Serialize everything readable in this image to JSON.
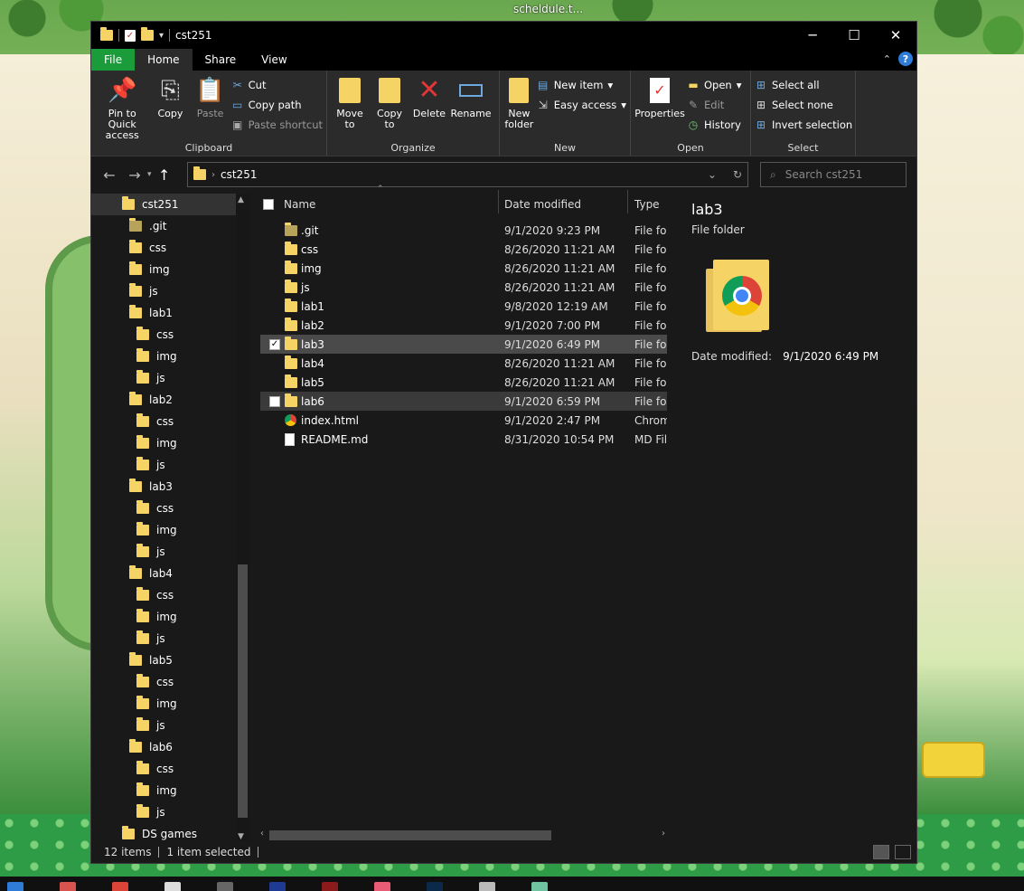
{
  "desktop": {
    "top_label": "scheldule.t..."
  },
  "window": {
    "title": "cst251",
    "controls": {
      "minimize": "─",
      "maximize": "☐",
      "close": "✕"
    }
  },
  "tabs": [
    "File",
    "Home",
    "Share",
    "View"
  ],
  "ribbon": {
    "clipboard": {
      "label": "Clipboard",
      "pin": "Pin to Quick access",
      "copy": "Copy",
      "paste": "Paste",
      "cut": "Cut",
      "copy_path": "Copy path",
      "paste_shortcut": "Paste shortcut"
    },
    "organize": {
      "label": "Organize",
      "move_to": "Move to",
      "copy_to": "Copy to",
      "delete": "Delete",
      "rename": "Rename"
    },
    "new": {
      "label": "New",
      "new_folder": "New folder",
      "new_item": "New item",
      "easy_access": "Easy access"
    },
    "open": {
      "label": "Open",
      "properties": "Properties",
      "open": "Open",
      "edit": "Edit",
      "history": "History"
    },
    "select": {
      "label": "Select",
      "select_all": "Select all",
      "select_none": "Select none",
      "invert": "Invert selection"
    }
  },
  "address": {
    "crumb": "cst251",
    "search_placeholder": "Search cst251"
  },
  "tree": [
    {
      "label": "cst251",
      "level": 0,
      "selected": true
    },
    {
      "label": ".git",
      "level": 1
    },
    {
      "label": "css",
      "level": 1
    },
    {
      "label": "img",
      "level": 1
    },
    {
      "label": "js",
      "level": 1
    },
    {
      "label": "lab1",
      "level": 1
    },
    {
      "label": "css",
      "level": 2
    },
    {
      "label": "img",
      "level": 2
    },
    {
      "label": "js",
      "level": 2
    },
    {
      "label": "lab2",
      "level": 1
    },
    {
      "label": "css",
      "level": 2
    },
    {
      "label": "img",
      "level": 2
    },
    {
      "label": "js",
      "level": 2
    },
    {
      "label": "lab3",
      "level": 1
    },
    {
      "label": "css",
      "level": 2
    },
    {
      "label": "img",
      "level": 2
    },
    {
      "label": "js",
      "level": 2
    },
    {
      "label": "lab4",
      "level": 1
    },
    {
      "label": "css",
      "level": 2
    },
    {
      "label": "img",
      "level": 2
    },
    {
      "label": "js",
      "level": 2
    },
    {
      "label": "lab5",
      "level": 1
    },
    {
      "label": "css",
      "level": 2
    },
    {
      "label": "img",
      "level": 2
    },
    {
      "label": "js",
      "level": 2
    },
    {
      "label": "lab6",
      "level": 1
    },
    {
      "label": "css",
      "level": 2
    },
    {
      "label": "img",
      "level": 2
    },
    {
      "label": "js",
      "level": 2
    },
    {
      "label": "DS games",
      "level": 0
    }
  ],
  "columns": {
    "name": "Name",
    "date": "Date modified",
    "type": "Type"
  },
  "files": [
    {
      "name": ".git",
      "date": "9/1/2020 9:23 PM",
      "type": "File folder",
      "icon": "folder-dark"
    },
    {
      "name": "css",
      "date": "8/26/2020 11:21 AM",
      "type": "File folder",
      "icon": "folder"
    },
    {
      "name": "img",
      "date": "8/26/2020 11:21 AM",
      "type": "File folder",
      "icon": "folder"
    },
    {
      "name": "js",
      "date": "8/26/2020 11:21 AM",
      "type": "File folder",
      "icon": "folder"
    },
    {
      "name": "lab1",
      "date": "9/8/2020 12:19 AM",
      "type": "File folder",
      "icon": "folder"
    },
    {
      "name": "lab2",
      "date": "9/1/2020 7:00 PM",
      "type": "File folder",
      "icon": "folder"
    },
    {
      "name": "lab3",
      "date": "9/1/2020 6:49 PM",
      "type": "File folder",
      "icon": "folder",
      "selected": true,
      "checked": true
    },
    {
      "name": "lab4",
      "date": "8/26/2020 11:21 AM",
      "type": "File folder",
      "icon": "folder"
    },
    {
      "name": "lab5",
      "date": "8/26/2020 11:21 AM",
      "type": "File folder",
      "icon": "folder"
    },
    {
      "name": "lab6",
      "date": "9/1/2020 6:59 PM",
      "type": "File folder",
      "icon": "folder",
      "hover": true
    },
    {
      "name": "index.html",
      "date": "9/1/2020 2:47 PM",
      "type": "Chrome HTML Document",
      "icon": "chrome"
    },
    {
      "name": "README.md",
      "date": "8/31/2020 10:54 PM",
      "type": "MD File",
      "icon": "file"
    }
  ],
  "preview": {
    "name": "lab3",
    "type": "File folder",
    "meta_label": "Date modified:",
    "meta_value": "9/1/2020 6:49 PM"
  },
  "status": {
    "count": "12 items",
    "selection": "1 item selected"
  },
  "colors": {
    "file_tab": "#1a9c3a",
    "folder": "#f6d365",
    "accent": "#2f7bd8"
  }
}
